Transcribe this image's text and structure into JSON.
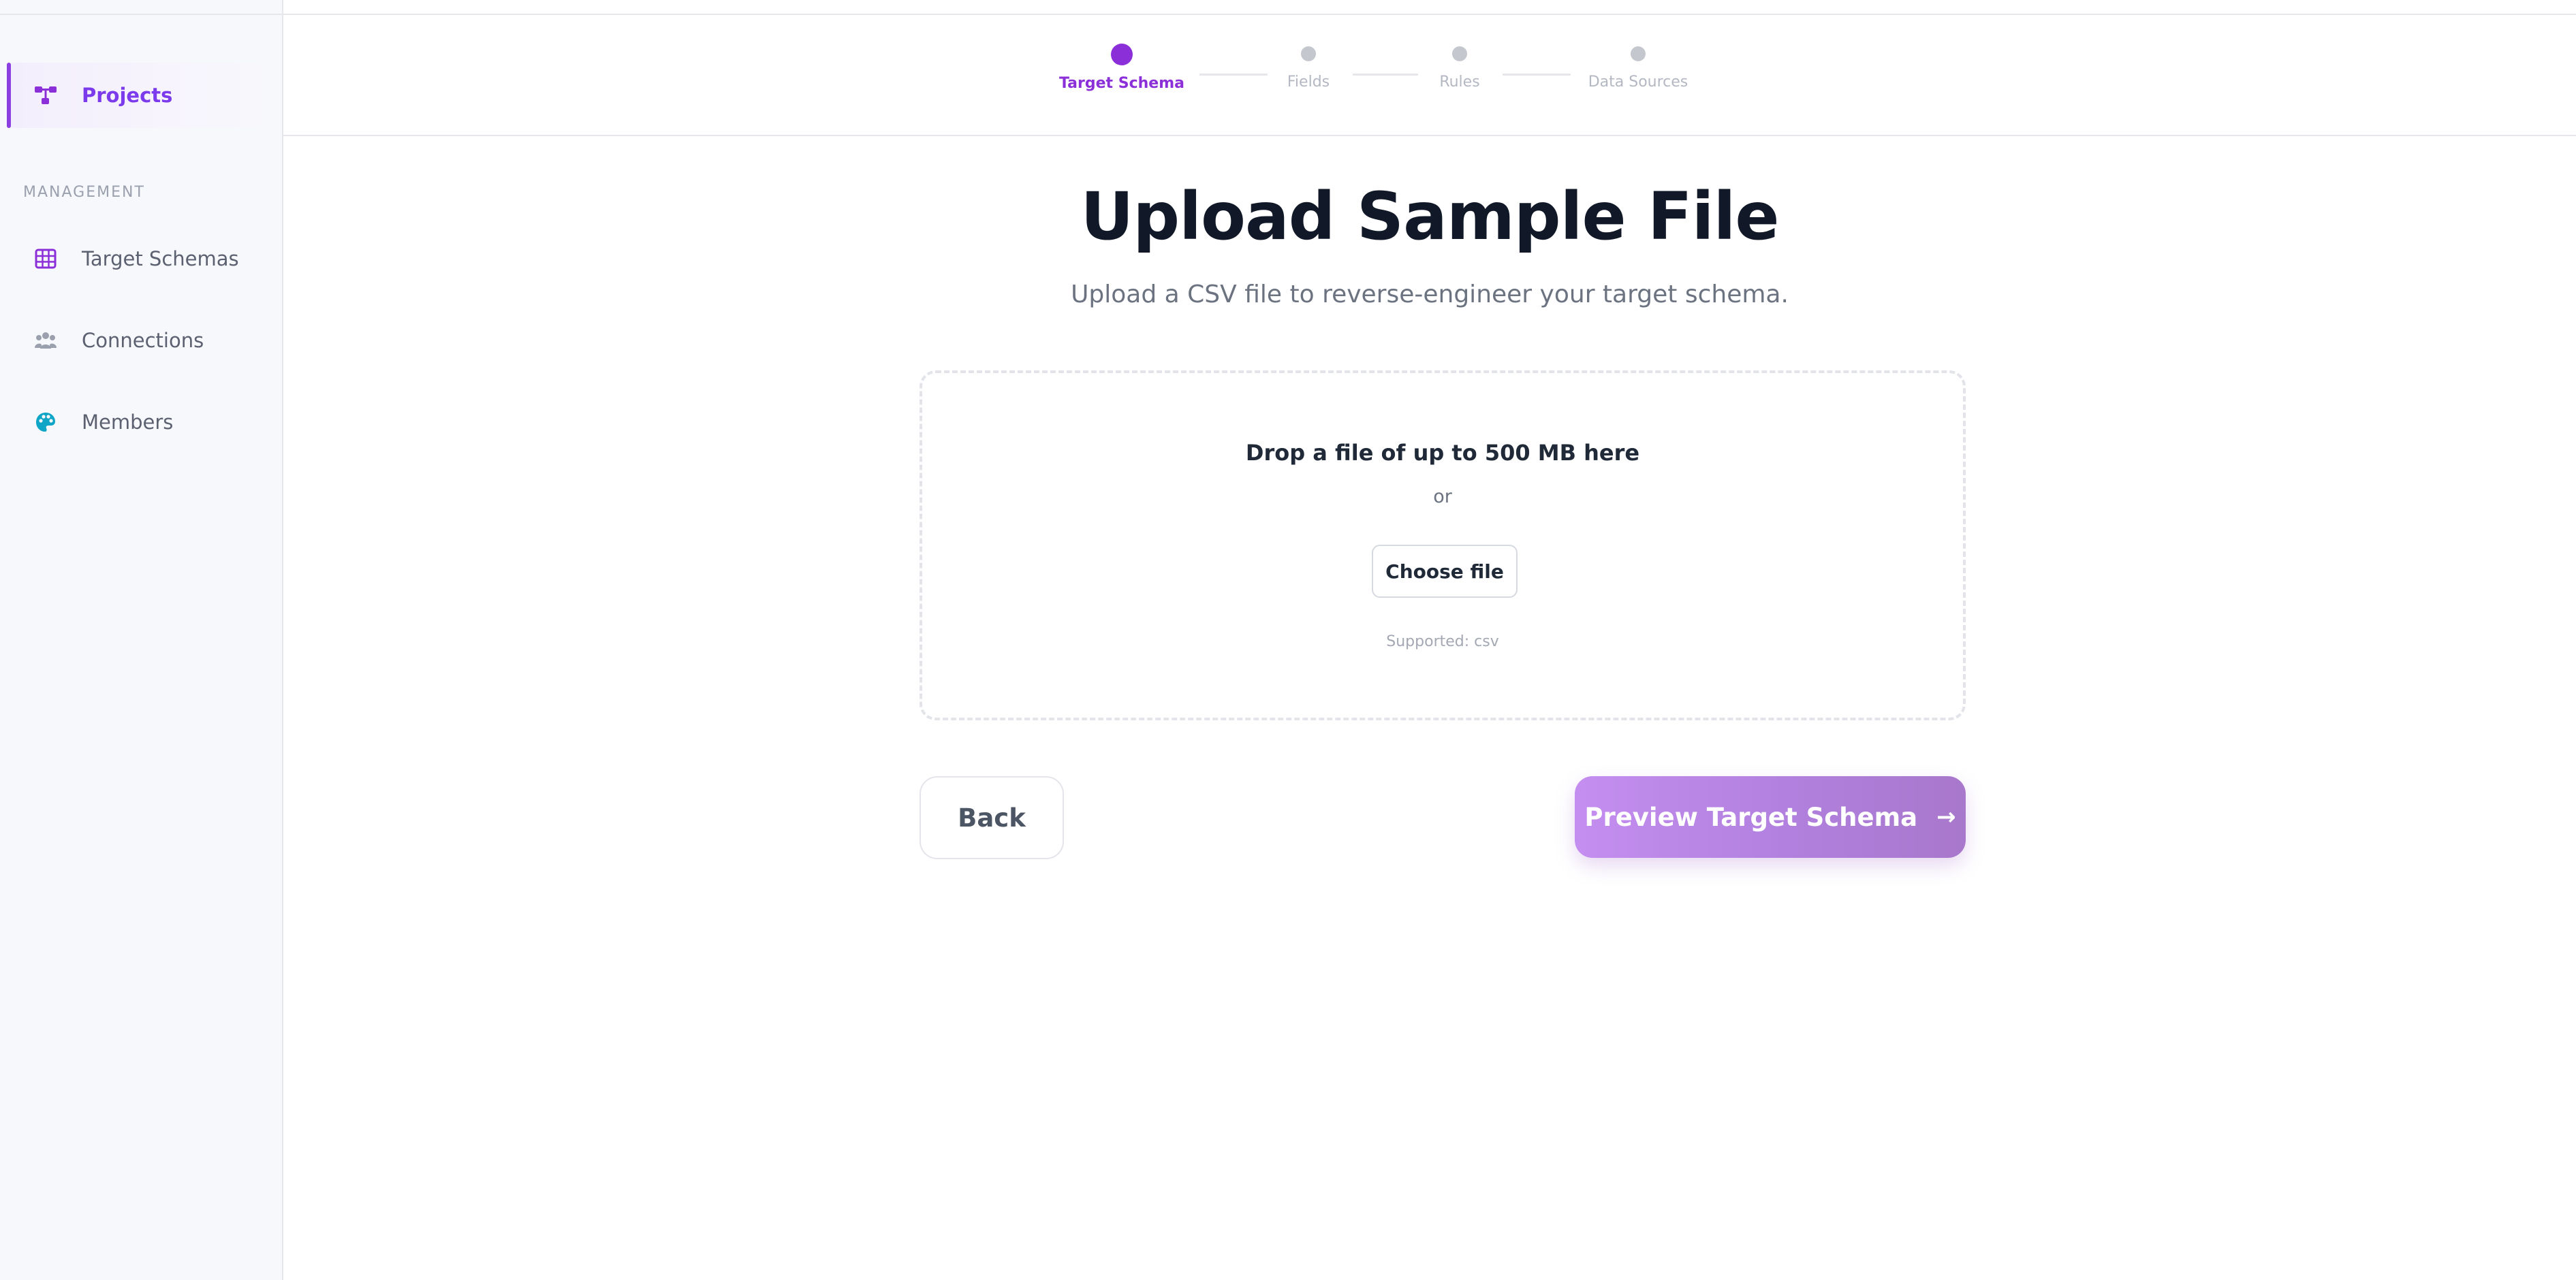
{
  "sidebar": {
    "primary_item": {
      "label": "Projects",
      "icon": "project-tree-icon",
      "active": true
    },
    "section_label": "MANAGEMENT",
    "items": [
      {
        "label": "Target Schemas",
        "icon": "table-grid-icon"
      },
      {
        "label": "Connections",
        "icon": "users-icon"
      },
      {
        "label": "Members",
        "icon": "palette-icon"
      }
    ]
  },
  "stepper": {
    "steps": [
      {
        "label": "Target Schema",
        "state": "active"
      },
      {
        "label": "Fields",
        "state": "upcoming"
      },
      {
        "label": "Rules",
        "state": "upcoming"
      },
      {
        "label": "Data Sources",
        "state": "upcoming"
      }
    ]
  },
  "page": {
    "title": "Upload Sample File",
    "subtitle": "Upload a CSV file to reverse-engineer your target schema."
  },
  "dropzone": {
    "title": "Drop a file of up to 500 MB here",
    "or_text": "or",
    "choose_label": "Choose file",
    "supported_text": "Supported: csv"
  },
  "actions": {
    "back_label": "Back",
    "primary_label": "Preview Target Schema",
    "primary_arrow": "→"
  },
  "colors": {
    "accent": "#8b2fd8",
    "accent_soft": "#c48ef0",
    "sidebar_bg": "#f7f8fc"
  }
}
